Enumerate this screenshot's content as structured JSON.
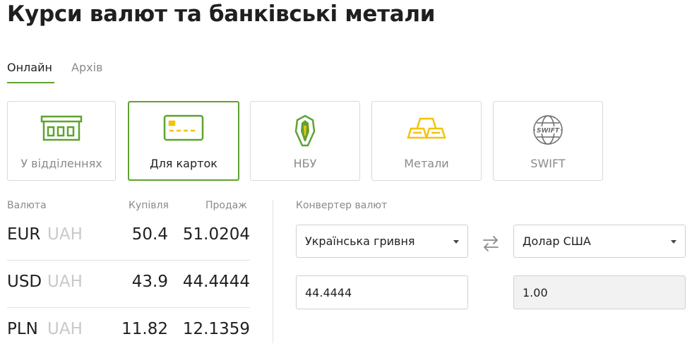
{
  "page": {
    "title": "Курси валют та банківські метали"
  },
  "tabs": [
    {
      "label": "Онлайн",
      "active": true
    },
    {
      "label": "Архів",
      "active": false
    }
  ],
  "categories": [
    {
      "label": "У відділеннях",
      "icon": "branch-icon"
    },
    {
      "label": "Для карток",
      "icon": "card-icon",
      "active": true
    },
    {
      "label": "НБУ",
      "icon": "nbu-icon"
    },
    {
      "label": "Метали",
      "icon": "metal-bars-icon"
    },
    {
      "label": "SWIFT",
      "icon": "swift-icon"
    }
  ],
  "rates": {
    "headers": {
      "currency": "Валюта",
      "buy": "Купівля",
      "sell": "Продаж"
    },
    "rows": [
      {
        "code": "EUR",
        "base": "UAH",
        "buy": "50.4",
        "sell": "51.0204"
      },
      {
        "code": "USD",
        "base": "UAH",
        "buy": "43.9",
        "sell": "44.4444"
      },
      {
        "code": "PLN",
        "base": "UAH",
        "buy": "11.82",
        "sell": "12.1359"
      }
    ]
  },
  "converter": {
    "title": "Конвертер валют",
    "from_currency": "Українська гривня",
    "to_currency": "Долар США",
    "from_amount": "44.4444",
    "to_amount": "1.00"
  },
  "colors": {
    "accent": "#5ea32f",
    "metal": "#f4c20d",
    "muted": "#8a8a8a"
  }
}
